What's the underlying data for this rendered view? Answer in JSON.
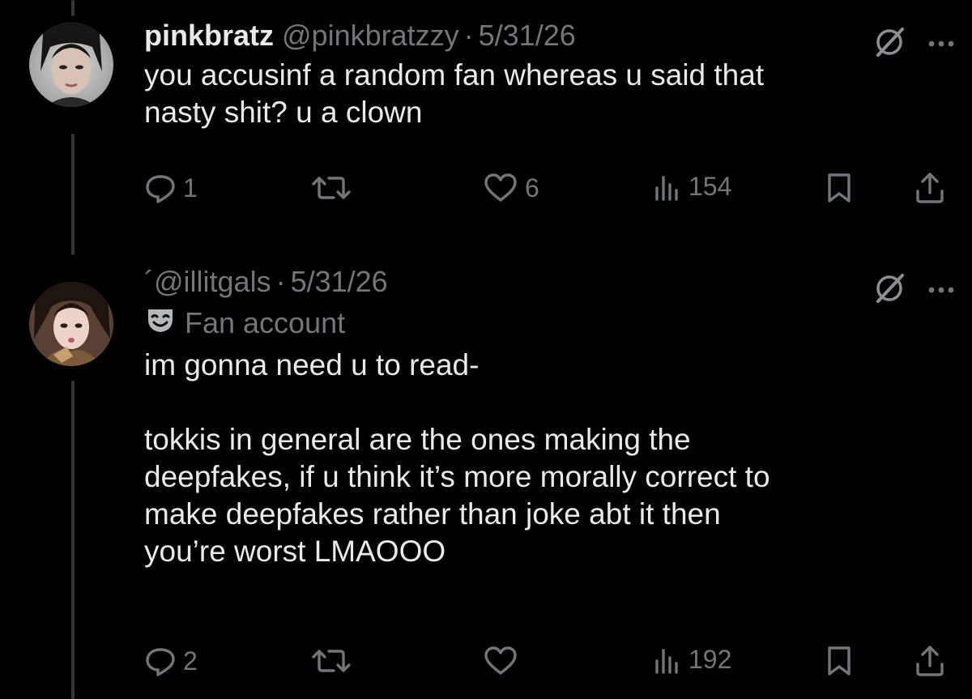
{
  "tweets": [
    {
      "name": "pinkbratz",
      "handle": "@pinkbratzzy",
      "separator": "·",
      "date": "5/31/26",
      "text": "you accusinf a random fan whereas u said that\nnasty shit? u a clown",
      "replies": "1",
      "likes": "6",
      "views": "154"
    },
    {
      "handle_prefix": "´",
      "handle": "@illitgals",
      "separator": "·",
      "date": "5/31/26",
      "badge": "Fan account",
      "text": "im gonna need u to read-\n\ntokkis in general are the ones making the\ndeepfakes, if u think it’s more morally correct to\nmake deepfakes rather than joke abt it then\nyou’re worst LMAOOO",
      "replies": "2",
      "likes": "",
      "views": "192"
    }
  ],
  "icons": [
    "grok-icon",
    "more-icon",
    "reply-icon",
    "retweet-icon",
    "like-icon",
    "views-icon",
    "bookmark-icon",
    "share-icon",
    "mask-icon"
  ],
  "colors": {
    "background": "#000000",
    "text": "#e7e9ea",
    "muted": "#71767b"
  }
}
